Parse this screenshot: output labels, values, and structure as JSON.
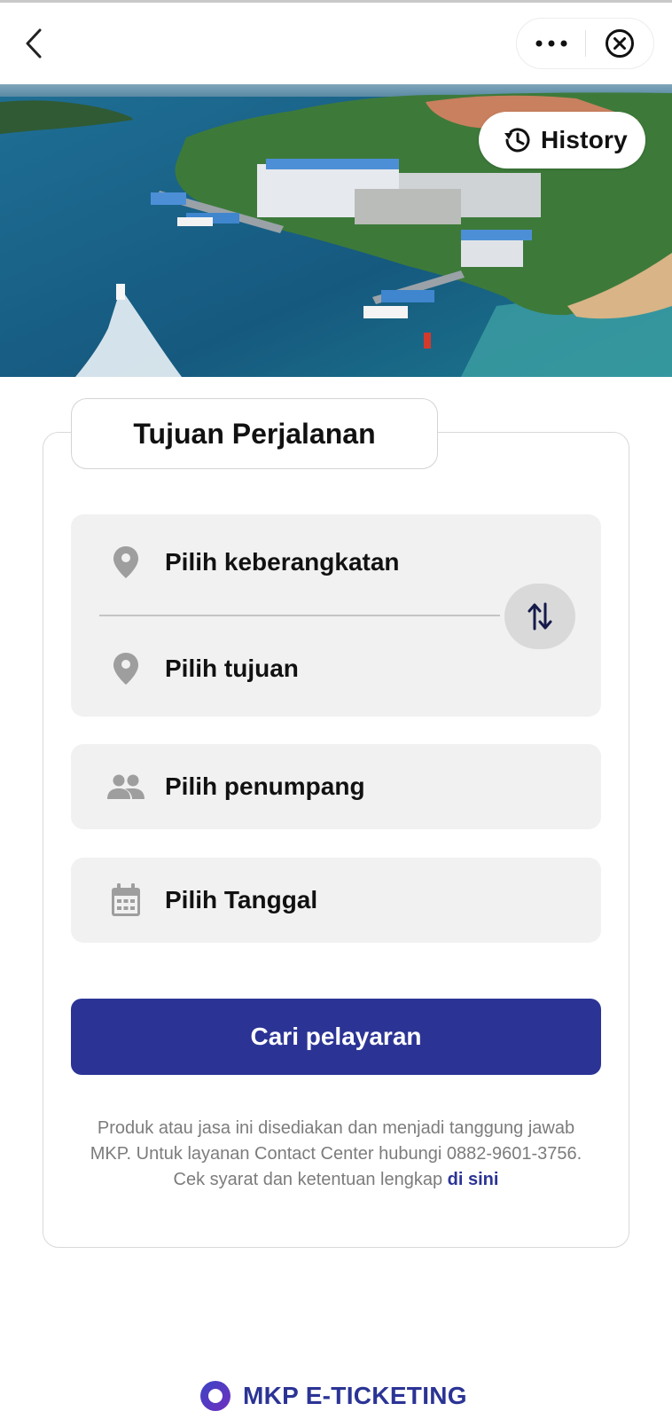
{
  "topbar": {
    "back_icon": "chevron-left-icon",
    "more_icon": "more-horizontal-icon",
    "close_icon": "close-circle-icon"
  },
  "hero": {
    "history_label": "History",
    "history_icon": "history-icon"
  },
  "form": {
    "title": "Tujuan Perjalanan",
    "departure_placeholder": "Pilih keberangkatan",
    "destination_placeholder": "Pilih tujuan",
    "passenger_placeholder": "Pilih penumpang",
    "date_placeholder": "Pilih Tanggal",
    "search_label": "Cari pelayaran",
    "swap_icon": "swap-vertical-icon"
  },
  "disclaimer": {
    "line1": "Produk atau jasa ini disediakan dan menjadi tanggung jawab",
    "line2": "MKP. Untuk layanan Contact Center hubungi 0882-9601-3756.",
    "line3_prefix": "Cek syarat dan ketentuan lengkap",
    "link_label": "di sini"
  },
  "brand": {
    "name": "MKP E-TICKETING"
  },
  "colors": {
    "primary": "#2b3495",
    "field_bg": "#f1f1f1",
    "icon_grey": "#9e9e9e"
  }
}
